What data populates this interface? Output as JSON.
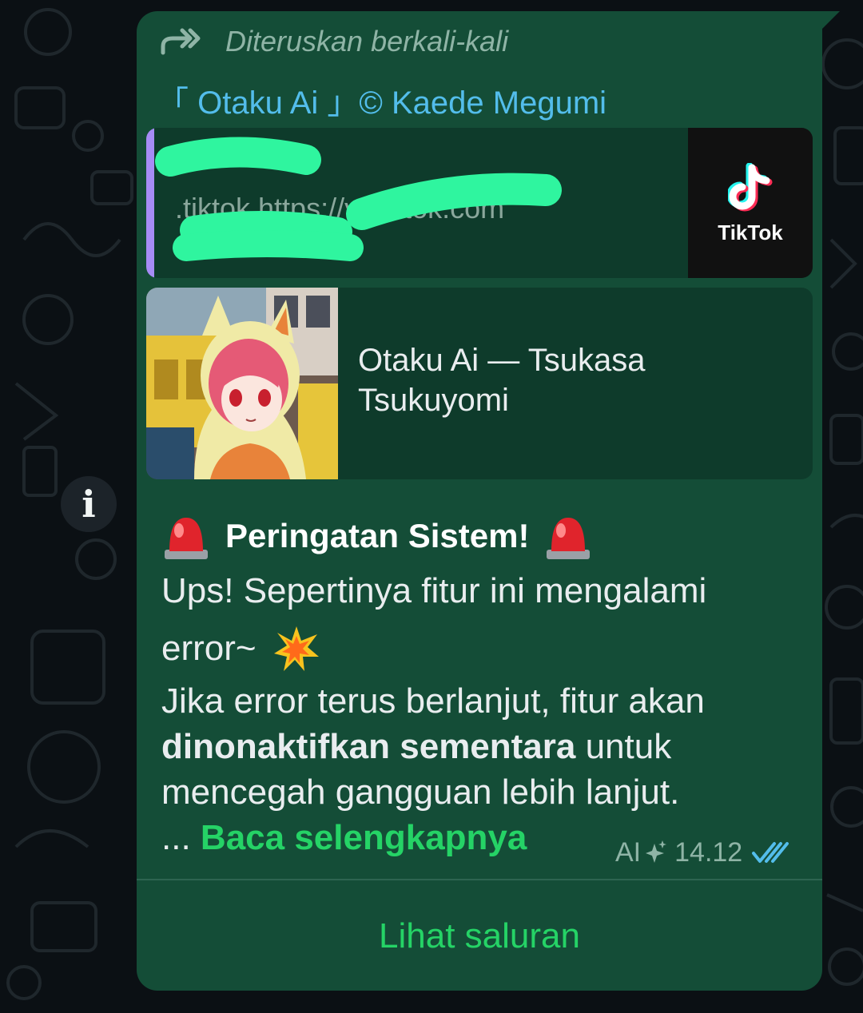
{
  "message": {
    "forwarded_label": "Diteruskan berkali-kali",
    "sender": "「 Otaku Ai 」© Kaede Megumi",
    "quoted": {
      "text_line1": ".tiktok https://vt.tiktok.com",
      "text_line2": "/",
      "thumb_label": "TikTok"
    },
    "link_preview": {
      "title_line1": "Otaku Ai — Tsukasa",
      "title_line2": "Tsukuyomi"
    },
    "alert_title": "Peringatan Sistem!",
    "body": {
      "line1": "Ups! Sepertinya fitur ini mengalami",
      "line2": "error~",
      "line3": "Jika error terus berlanjut, fitur akan",
      "line4_bold": "dinonaktifkan sementara",
      "line4_rest": " untuk",
      "line5": "mencegah gangguan lebih lanjut.",
      "ellipsis": "...",
      "read_more": "Baca selengkapnya"
    },
    "meta": {
      "ai_label": "AI",
      "time": "14.12"
    },
    "channel_button": "Lihat saluran"
  },
  "colors": {
    "bubble": "#144d37",
    "link": "#53bdeb",
    "accent": "#25d366",
    "quote_bar": "#a68cf5",
    "read_ticks": "#53bdeb"
  },
  "icons": [
    "forward-icon",
    "info-icon",
    "tiktok-logo-icon",
    "siren-icon",
    "collision-icon",
    "ai-sparkle-icon",
    "double-check-icon"
  ]
}
